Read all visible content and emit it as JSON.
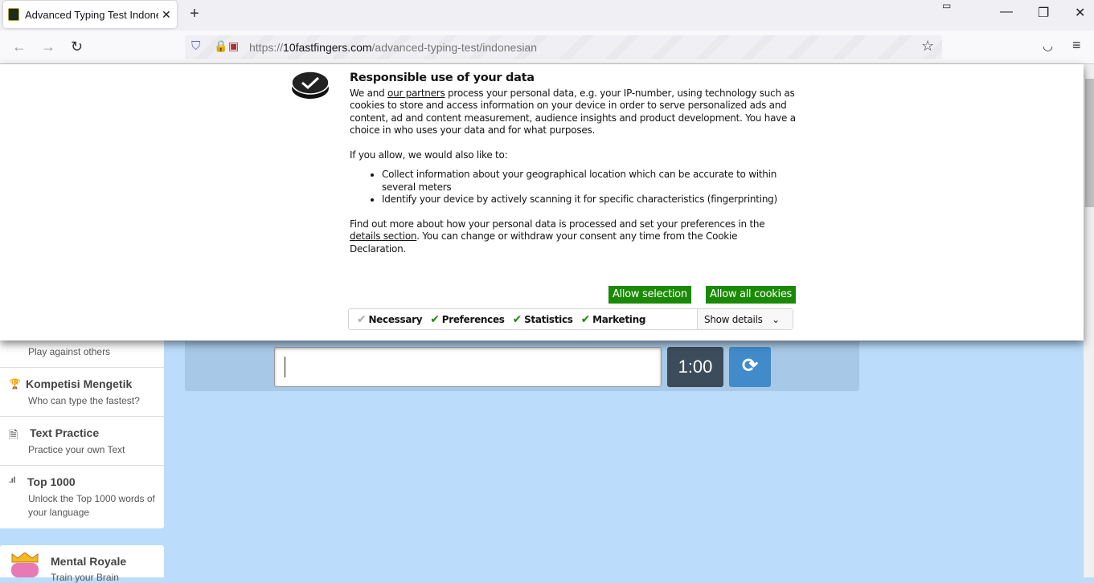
{
  "browser": {
    "tab_title": "Advanced Typing Test Indonesian",
    "url_prefix": "https://",
    "url_domain": "10fastfingers.com",
    "url_path": "/advanced-typing-test/indonesian"
  },
  "consent": {
    "title": "Responsible use of your data",
    "p1_a": "We and ",
    "p1_link": "our partners",
    "p1_b": " process your personal data, e.g. your IP-number, using technology such as cookies to store and access information on your device in order to serve personalized ads and content, ad and content measurement, audience insights and product development. You have a choice in who uses your data and for what purposes.",
    "p2": "If you allow, we would also like to:",
    "bullets": [
      "Collect information about your geographical location which can be accurate to within several meters",
      "Identify your device by actively scanning it for specific characteristics (fingerprinting)"
    ],
    "p3_a": "Find out more about how your personal data is processed and set your preferences in the ",
    "p3_link": "details section",
    "p3_b": ". You can change or withdraw your consent any time from the Cookie Declaration.",
    "allow_selection": "Allow selection",
    "allow_all": "Allow all cookies",
    "checks": [
      "Necessary",
      "Preferences",
      "Statistics",
      "Marketing"
    ],
    "show_details": "Show details",
    "accent": "#1a8a05"
  },
  "sidebar": {
    "items": [
      {
        "subtitle": "Play against others"
      },
      {
        "title": "Kompetisi Mengetik",
        "subtitle": "Who can type the fastest?",
        "icon": "trophy-icon"
      },
      {
        "title": "Text Practice",
        "subtitle": "Practice your own Text",
        "icon": "document-icon"
      },
      {
        "title": "Top 1000",
        "subtitle": "Unlock the Top 1000 words of your language",
        "icon": "signal-bars-icon"
      }
    ],
    "royale": {
      "title": "Mental Royale",
      "subtitle": "Train your Brain"
    }
  },
  "typing": {
    "input_value": "",
    "timer": "1:00"
  }
}
